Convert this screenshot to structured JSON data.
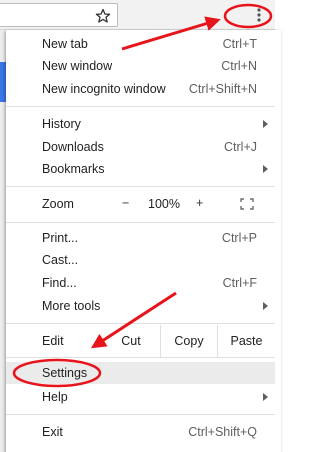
{
  "menu": {
    "group1": [
      {
        "label": "New tab",
        "shortcut": "Ctrl+T"
      },
      {
        "label": "New window",
        "shortcut": "Ctrl+N"
      },
      {
        "label": "New incognito window",
        "shortcut": "Ctrl+Shift+N"
      }
    ],
    "group2": [
      {
        "label": "History"
      },
      {
        "label": "Downloads",
        "shortcut": "Ctrl+J"
      },
      {
        "label": "Bookmarks"
      }
    ],
    "zoom": {
      "label": "Zoom",
      "minus": "−",
      "value": "100%",
      "plus": "+"
    },
    "group3": [
      {
        "label": "Print...",
        "shortcut": "Ctrl+P"
      },
      {
        "label": "Cast..."
      },
      {
        "label": "Find...",
        "shortcut": "Ctrl+F"
      },
      {
        "label": "More tools"
      }
    ],
    "edit": {
      "label": "Edit",
      "cut": "Cut",
      "copy": "Copy",
      "paste": "Paste"
    },
    "group4": [
      {
        "label": "Settings"
      },
      {
        "label": "Help"
      }
    ],
    "group5": [
      {
        "label": "Exit",
        "shortcut": "Ctrl+Shift+Q"
      }
    ]
  },
  "icons": {
    "star": "star-icon",
    "menu": "three-dot-menu-icon",
    "fullscreen": "fullscreen-icon"
  },
  "colors": {
    "annotation": "#e8141c",
    "selection": "#ebebeb"
  }
}
